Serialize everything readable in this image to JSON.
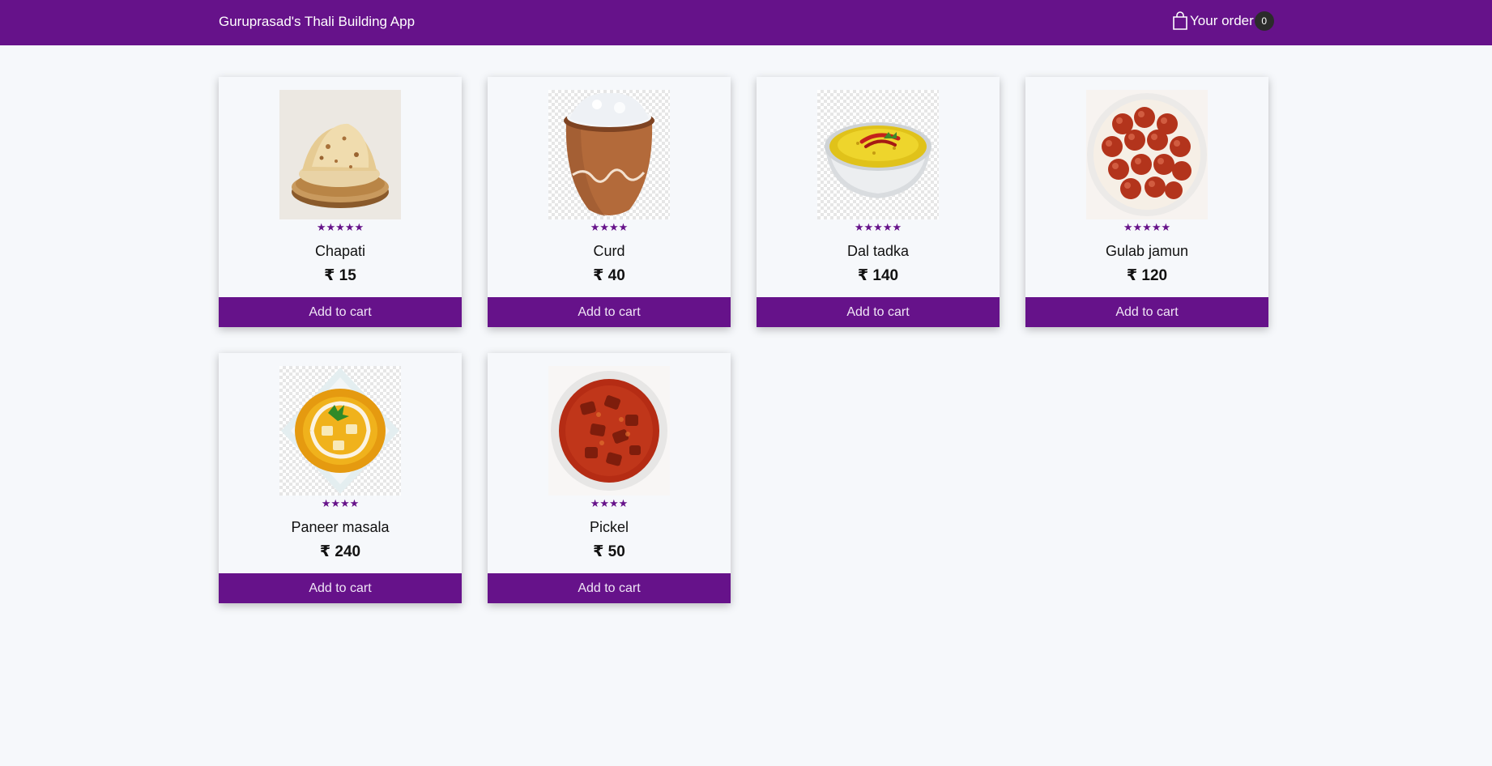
{
  "header": {
    "brand": "Guruprasad's Thali Building App",
    "order_label": "Your order",
    "order_count": "0",
    "bag_icon": "shopping-bag-icon"
  },
  "colors": {
    "accent": "#66128a",
    "background": "#f6f8fb"
  },
  "products": [
    {
      "name": "Chapati",
      "price": "₹ 15",
      "stars": "★★★★★",
      "rating": 5,
      "image": "chapati-image",
      "button": "Add to cart"
    },
    {
      "name": "Curd",
      "price": "₹ 40",
      "stars": "★★★★",
      "rating": 4,
      "image": "curd-image",
      "button": "Add to cart"
    },
    {
      "name": "Dal tadka",
      "price": "₹ 140",
      "stars": "★★★★★",
      "rating": 5,
      "image": "dal-tadka-image",
      "button": "Add to cart"
    },
    {
      "name": "Gulab jamun",
      "price": "₹ 120",
      "stars": "★★★★★",
      "rating": 5,
      "image": "gulab-jamun-image",
      "button": "Add to cart"
    },
    {
      "name": "Paneer masala",
      "price": "₹ 240",
      "stars": "★★★★",
      "rating": 4,
      "image": "paneer-masala-image",
      "button": "Add to cart"
    },
    {
      "name": "Pickel",
      "price": "₹ 50",
      "stars": "★★★★",
      "rating": 4,
      "image": "pickle-image",
      "button": "Add to cart"
    }
  ]
}
